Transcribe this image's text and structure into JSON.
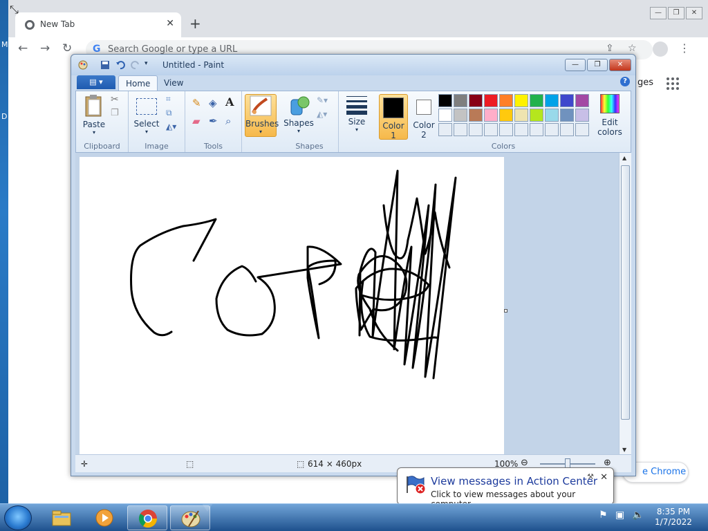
{
  "desktop": {
    "letters": [
      "M",
      "D"
    ]
  },
  "chrome": {
    "tab_title": "New Tab",
    "omnibox_placeholder": "Search Google or type a URL",
    "images_link": "ges",
    "customize_label": "e Chrome"
  },
  "paint": {
    "window_title": "Untitled - Paint",
    "tabs": [
      "Home",
      "View"
    ],
    "groups": {
      "clipboard": "Clipboard",
      "image": "Image",
      "tools": "Tools",
      "shapes": "Shapes",
      "colors": "Colors"
    },
    "buttons": {
      "paste": "Paste",
      "select": "Select",
      "brushes": "Brushes",
      "shapes": "Shapes",
      "size": "Size",
      "color1": "Color",
      "color1_num": "1",
      "color2": "Color",
      "color2_num": "2",
      "edit_colors_1": "Edit",
      "edit_colors_2": "colors"
    },
    "color1_value": "#000000",
    "color2_value": "#ffffff",
    "palette": [
      "#000000",
      "#7f7f7f",
      "#880015",
      "#ed1c24",
      "#ff7f27",
      "#fff200",
      "#22b14c",
      "#00a2e8",
      "#3f48cc",
      "#a349a4",
      "#ffffff",
      "#c3c3c3",
      "#b97a57",
      "#ffaec9",
      "#ffc90e",
      "#efe4b0",
      "#b5e61d",
      "#99d9ea",
      "#7092be",
      "#c8bfe7",
      "#e6edf5",
      "#e6edf5",
      "#e6edf5",
      "#e6edf5",
      "#e6edf5",
      "#e6edf5",
      "#e6edf5",
      "#e6edf5",
      "#e6edf5",
      "#e6edf5"
    ],
    "status": {
      "image_size": "614 × 460px",
      "zoom": "100%"
    }
  },
  "notification": {
    "title": "View messages in Action Center",
    "text": "Click to view messages about your computer."
  },
  "taskbar": {
    "time": "8:35 PM",
    "date": "1/7/2022"
  }
}
